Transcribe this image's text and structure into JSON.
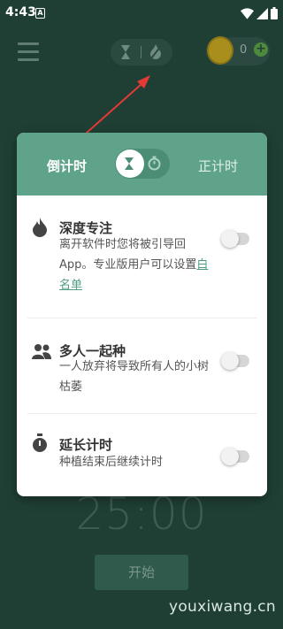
{
  "status_bar": {
    "time": "4:43",
    "notification_glyph": "A"
  },
  "coins": {
    "count": "0",
    "add_symbol": "+"
  },
  "modal": {
    "tab_left": "倒计时",
    "tab_right": "正计时",
    "options": [
      {
        "title": "深度专注",
        "desc_main": "离开软件时您将被引导回App。专业版用户可以设置",
        "desc_link": "白名单",
        "icon": "flame-icon",
        "enabled": false
      },
      {
        "title": "多人一起种",
        "desc_main": "一人放弃将导致所有人的小树枯萎",
        "desc_link": "",
        "icon": "people-icon",
        "enabled": false
      },
      {
        "title": "延长计时",
        "desc_main": "种植结束后继续计时",
        "desc_link": "",
        "icon": "stopwatch-icon",
        "enabled": false
      }
    ]
  },
  "timer": {
    "value": "25:00"
  },
  "start_button": {
    "label": "开始"
  },
  "watermark": "youxiwang.cn",
  "colors": {
    "accent": "#5fa38a",
    "background": "#1f3f35",
    "arrow": "#e53935",
    "link": "#4f9c80"
  }
}
